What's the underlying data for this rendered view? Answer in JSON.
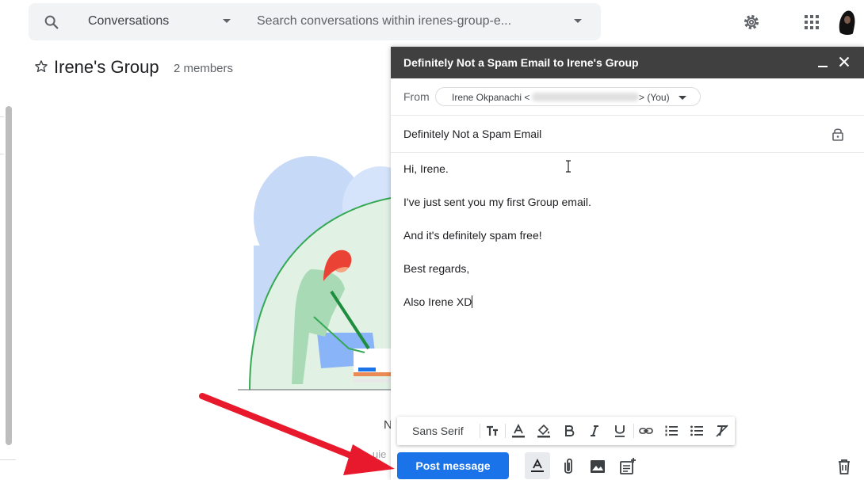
{
  "search": {
    "scope_label": "Conversations",
    "query_placeholder": "Search conversations within irenes-group-e..."
  },
  "icons": {
    "search": "search-icon",
    "settings": "gear-icon",
    "apps": "apps-grid-icon",
    "star": "star-outline-icon"
  },
  "group": {
    "title": "Irene's Group",
    "member_count": "2 members"
  },
  "background_peek": {
    "partial_text_1": "N",
    "partial_text_2": "uie"
  },
  "compose": {
    "title": "Definitely Not a Spam Email to Irene's Group",
    "from_label": "From",
    "from_name": "Irene Okpanachi <",
    "from_suffix": "> (You)",
    "subject": "Definitely Not a Spam Email",
    "body_lines": [
      "Hi, Irene.",
      "I've just sent you my first Group email.",
      "And it's definitely spam free!",
      "Best regards,",
      "Also Irene XD"
    ],
    "font_name": "Sans Serif",
    "send_label": "Post message"
  },
  "colors": {
    "accent": "#1a73e8",
    "header": "#404040",
    "arrow": "#e8192c"
  }
}
